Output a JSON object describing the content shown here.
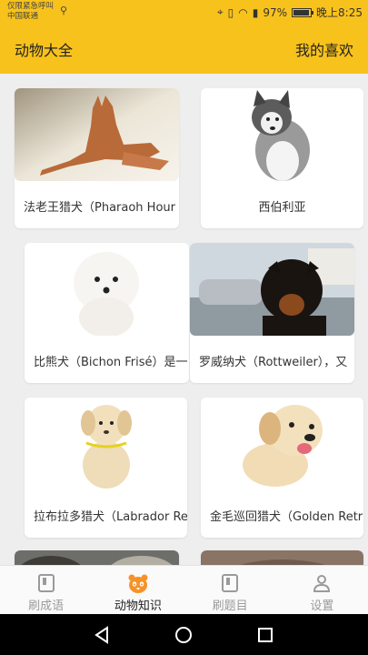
{
  "status": {
    "carrier_line1": "仅限紧急呼叫",
    "carrier_line2": "中国联通",
    "battery_percent": "97%",
    "time": "晚上8:25",
    "battery_level": 0.97
  },
  "appbar": {
    "title": "动物大全",
    "favorites": "我的喜欢"
  },
  "cards": [
    {
      "label": "法老王猎犬（Pharaoh Hour"
    },
    {
      "label": "西伯利亚"
    },
    {
      "label": "比熊犬（Bichon Frisé）是一"
    },
    {
      "label": "罗威纳犬（Rottweiler），又"
    },
    {
      "label": "拉布拉多猎犬（Labrador Re"
    },
    {
      "label": "金毛巡回猎犬（Golden Retr"
    }
  ],
  "tabs": [
    {
      "label": "刷成语",
      "icon": "book-icon"
    },
    {
      "label": "动物知识",
      "icon": "panda-icon"
    },
    {
      "label": "刷题目",
      "icon": "book-icon"
    },
    {
      "label": "设置",
      "icon": "user-icon"
    }
  ],
  "colors": {
    "accent": "#f8c21c",
    "tab_active_icon": "#f5932a",
    "tab_inactive": "#9a9a9a"
  }
}
